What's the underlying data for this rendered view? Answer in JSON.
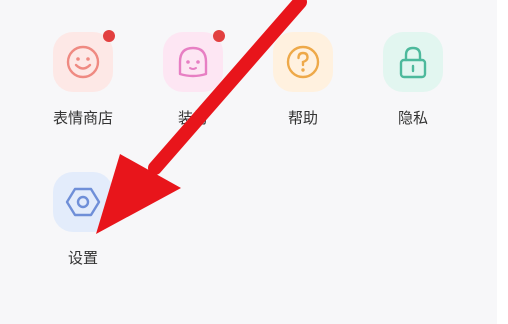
{
  "grid": {
    "items": [
      {
        "label": "表情商店",
        "icon": "smiley-face-icon",
        "badge": true,
        "bg": "#fde8e6",
        "stroke": "#ef8a82"
      },
      {
        "label": "装扮",
        "icon": "ghost-face-icon",
        "badge": true,
        "bg": "#fde6f3",
        "stroke": "#e77fc3"
      },
      {
        "label": "帮助",
        "icon": "question-icon",
        "badge": false,
        "bg": "#fff1df",
        "stroke": "#eea949"
      },
      {
        "label": "隐私",
        "icon": "lock-icon",
        "badge": false,
        "bg": "#e2f6f0",
        "stroke": "#4db99c"
      },
      {
        "label": "设置",
        "icon": "hexagon-settings-icon",
        "badge": false,
        "bg": "#e3ecfb",
        "stroke": "#6f8fd8"
      }
    ]
  },
  "colors": {
    "background": "#f7f7f9",
    "badge": "#e24040",
    "arrow": "#e8151b"
  }
}
